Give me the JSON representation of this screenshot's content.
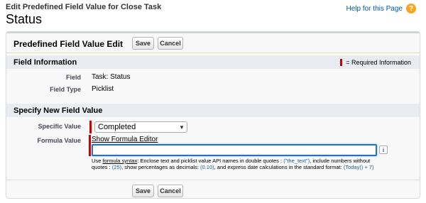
{
  "header": {
    "subtitle": "Edit Predefined Field Value for Close Task",
    "title": "Status",
    "help_label": "Help for this Page",
    "help_icon": "?"
  },
  "panel": {
    "title": "Predefined Field Value Edit",
    "save_label": "Save",
    "cancel_label": "Cancel"
  },
  "field_info": {
    "section_title": "Field Information",
    "required_legend": "= Required Information",
    "rows": [
      {
        "label": "Field",
        "value": "Task: Status"
      },
      {
        "label": "Field Type",
        "value": "Picklist"
      }
    ]
  },
  "new_value": {
    "section_title": "Specify New Field Value",
    "specific_label": "Specific Value",
    "specific_selected": "Completed",
    "formula_label": "Formula Value",
    "formula_editor_link": "Show Formula Editor",
    "formula_value": "",
    "info_icon": "i",
    "hint": {
      "use": "Use",
      "syntax_link": "formula syntax",
      "part1": ": Enclose text and picklist value API names in double quotes :",
      "code1": "(\"the_text\")",
      "part2": ", include numbers without quotes :",
      "code2": "(25)",
      "part3": ", show percentages as decimals:",
      "code3": "(0.10)",
      "part4": ", and express date calculations in the standard format:",
      "code4": "(Today() + 7)"
    }
  },
  "colors": {
    "required": "#cc0000",
    "link": "#015ba7",
    "section_bg": "#e9edf1",
    "focus_border": "#1e76c4"
  }
}
